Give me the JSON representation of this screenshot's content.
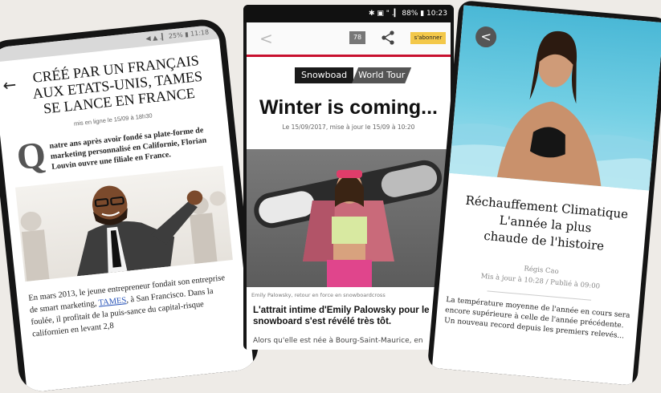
{
  "phone_left": {
    "status": "◀ ▲ .▎ 25% ▮ 11:18",
    "title": "CRÉÉ PAR UN FRANÇAIS AUX ETATS-UNIS, TAMES SE LANCE EN FRANCE",
    "meta": "mis en ligne le 15/09 à 18h30",
    "dropcap": "Q",
    "lead": "natre ans après avoir fondé sa plate-forme de marketing personnalisé en Californie, Florian Louvin ouvre une filiale en France.",
    "body_before_link": "En mars 2013, le jeune entrepreneur fondait son entreprise de smart marketing, ",
    "body_link": "TAMES",
    "body_after_link": ", à San Francisco. Dans la foulée, il profitait de la puis-sance du capital-risque californien en levant 2,8"
  },
  "phone_center": {
    "status": "✱ ▣ \" .▎ 88% ▮ 10:23",
    "back_glyph": "<",
    "comment_count": "78",
    "subscribe_label": "s'abonner",
    "tag_primary": "Snowboad",
    "tag_secondary": "World Tour",
    "headline": "Winter is coming...",
    "date": "Le 15/09/2017, mise à jour le 15/09 à 10:20",
    "caption": "Emily Palowsky, retour en force en snowboardcross",
    "article_title": "L'attrait intime d'Emily Palowsky pour le snowboard s'est révélé très tôt.",
    "article_body": "Alors qu'elle est née à Bourg-Saint-Maurice, en"
  },
  "phone_right": {
    "back_glyph": "<",
    "title_line1": "Réchauffement Climatique",
    "title_line2": "L'année la plus",
    "title_line3": "chaude de l'histoire",
    "author": "Régis Cao",
    "dates": "Mis à jour à 10:28 / Publié à 09:00",
    "body": "La température moyenne de l'année en cours sera encore supérieure à celle de l'année précédente. Un nouveau record depuis les premiers relevés..."
  }
}
